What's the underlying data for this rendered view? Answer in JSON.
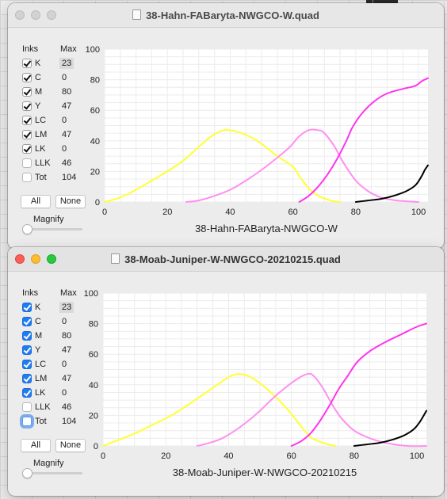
{
  "windows": [
    {
      "title": "38-Hahn-FABaryta-NWGCO-W.quad",
      "active": false,
      "inks_header": "Inks",
      "max_header": "Max",
      "inks": [
        {
          "name": "K",
          "max": "23",
          "checked": true
        },
        {
          "name": "C",
          "max": "0",
          "checked": true
        },
        {
          "name": "M",
          "max": "80",
          "checked": true
        },
        {
          "name": "Y",
          "max": "47",
          "checked": true
        },
        {
          "name": "LC",
          "max": "0",
          "checked": true
        },
        {
          "name": "LM",
          "max": "47",
          "checked": true
        },
        {
          "name": "LK",
          "max": "0",
          "checked": true
        },
        {
          "name": "LLK",
          "max": "46",
          "checked": false
        },
        {
          "name": "Tot",
          "max": "104",
          "checked": false
        }
      ],
      "all_label": "All",
      "none_label": "None",
      "magnify_label": "Magnify",
      "magnify_value": 0,
      "chart_data": {
        "type": "line",
        "xlabel": "38-Hahn-FABaryta-NWGCO-W",
        "xlim": [
          0,
          103
        ],
        "ylim": [
          0,
          100
        ],
        "x_ticks": [
          0,
          20,
          40,
          60,
          80,
          100
        ],
        "y_ticks": [
          0,
          20,
          40,
          60,
          80,
          100
        ],
        "grid": true,
        "series": [
          {
            "color": "#ffff33",
            "points": [
              [
                0,
                0
              ],
              [
                5,
                3
              ],
              [
                10,
                8
              ],
              [
                15,
                14
              ],
              [
                20,
                20
              ],
              [
                25,
                27
              ],
              [
                30,
                36
              ],
              [
                34,
                43
              ],
              [
                38,
                47
              ],
              [
                42,
                46
              ],
              [
                46,
                43
              ],
              [
                50,
                38
              ],
              [
                55,
                30
              ],
              [
                60,
                23
              ],
              [
                62,
                17
              ],
              [
                65,
                9
              ],
              [
                68,
                4
              ],
              [
                72,
                1
              ],
              [
                75,
                0
              ]
            ]
          },
          {
            "color": "#ff8ff0",
            "points": [
              [
                26,
                0
              ],
              [
                30,
                1
              ],
              [
                35,
                4
              ],
              [
                40,
                8
              ],
              [
                45,
                14
              ],
              [
                50,
                21
              ],
              [
                55,
                29
              ],
              [
                59,
                36
              ],
              [
                62,
                43
              ],
              [
                65,
                47
              ],
              [
                68,
                47
              ],
              [
                70,
                45
              ],
              [
                73,
                37
              ],
              [
                76,
                26
              ],
              [
                80,
                14
              ],
              [
                84,
                7
              ],
              [
                88,
                3
              ],
              [
                93,
                1
              ],
              [
                100,
                0
              ]
            ]
          },
          {
            "color": "#ff33ee",
            "points": [
              [
                62,
                0
              ],
              [
                65,
                4
              ],
              [
                68,
                10
              ],
              [
                71,
                18
              ],
              [
                74,
                28
              ],
              [
                77,
                40
              ],
              [
                79,
                49
              ],
              [
                82,
                58
              ],
              [
                86,
                66
              ],
              [
                90,
                71
              ],
              [
                95,
                74
              ],
              [
                99,
                76
              ],
              [
                101,
                79
              ],
              [
                103,
                81
              ]
            ]
          },
          {
            "color": "#000000",
            "points": [
              [
                80,
                0
              ],
              [
                84,
                1
              ],
              [
                88,
                2
              ],
              [
                92,
                4
              ],
              [
                96,
                7
              ],
              [
                99,
                11
              ],
              [
                101,
                17
              ],
              [
                102,
                21
              ],
              [
                103,
                24
              ]
            ]
          }
        ]
      }
    },
    {
      "title": "38-Moab-Juniper-W-NWGCO-20210215.quad",
      "active": true,
      "inks_header": "Inks",
      "max_header": "Max",
      "inks": [
        {
          "name": "K",
          "max": "23",
          "checked": true
        },
        {
          "name": "C",
          "max": "0",
          "checked": true
        },
        {
          "name": "M",
          "max": "80",
          "checked": true
        },
        {
          "name": "Y",
          "max": "47",
          "checked": true
        },
        {
          "name": "LC",
          "max": "0",
          "checked": true
        },
        {
          "name": "LM",
          "max": "47",
          "checked": true
        },
        {
          "name": "LK",
          "max": "0",
          "checked": true
        },
        {
          "name": "LLK",
          "max": "46",
          "checked": false
        },
        {
          "name": "Tot",
          "max": "104",
          "checked": false,
          "focused": true
        }
      ],
      "all_label": "All",
      "none_label": "None",
      "magnify_label": "Magnify",
      "magnify_value": 0,
      "chart_data": {
        "type": "line",
        "xlabel": "38-Moab-Juniper-W-NWGCO-20210215",
        "xlim": [
          0,
          103
        ],
        "ylim": [
          0,
          100
        ],
        "x_ticks": [
          0,
          20,
          40,
          60,
          80,
          100
        ],
        "y_ticks": [
          0,
          20,
          40,
          60,
          80,
          100
        ],
        "grid": true,
        "series": [
          {
            "color": "#ffff33",
            "points": [
              [
                0,
                0
              ],
              [
                5,
                4
              ],
              [
                10,
                8
              ],
              [
                15,
                13
              ],
              [
                20,
                18
              ],
              [
                25,
                24
              ],
              [
                30,
                31
              ],
              [
                35,
                38
              ],
              [
                40,
                45
              ],
              [
                43,
                47
              ],
              [
                46,
                46
              ],
              [
                50,
                41
              ],
              [
                55,
                32
              ],
              [
                60,
                21
              ],
              [
                63,
                13
              ],
              [
                66,
                6
              ],
              [
                70,
                2
              ],
              [
                74,
                0
              ]
            ]
          },
          {
            "color": "#ff8ff0",
            "points": [
              [
                30,
                0
              ],
              [
                34,
                2
              ],
              [
                38,
                5
              ],
              [
                42,
                10
              ],
              [
                46,
                16
              ],
              [
                50,
                23
              ],
              [
                54,
                31
              ],
              [
                58,
                38
              ],
              [
                62,
                44
              ],
              [
                65,
                47
              ],
              [
                67,
                46
              ],
              [
                70,
                38
              ],
              [
                73,
                27
              ],
              [
                76,
                18
              ],
              [
                80,
                10
              ],
              [
                85,
                5
              ],
              [
                90,
                2
              ],
              [
                97,
                0
              ],
              [
                103,
                0
              ]
            ]
          },
          {
            "color": "#ff33ee",
            "points": [
              [
                60,
                0
              ],
              [
                63,
                3
              ],
              [
                66,
                8
              ],
              [
                69,
                16
              ],
              [
                72,
                26
              ],
              [
                75,
                37
              ],
              [
                78,
                46
              ],
              [
                81,
                55
              ],
              [
                85,
                62
              ],
              [
                90,
                68
              ],
              [
                95,
                73
              ],
              [
                100,
                78
              ],
              [
                103,
                80
              ]
            ]
          },
          {
            "color": "#000000",
            "points": [
              [
                80,
                0
              ],
              [
                84,
                1
              ],
              [
                88,
                2
              ],
              [
                92,
                4
              ],
              [
                96,
                7
              ],
              [
                99,
                11
              ],
              [
                101,
                16
              ],
              [
                103,
                23
              ]
            ]
          }
        ]
      }
    }
  ]
}
